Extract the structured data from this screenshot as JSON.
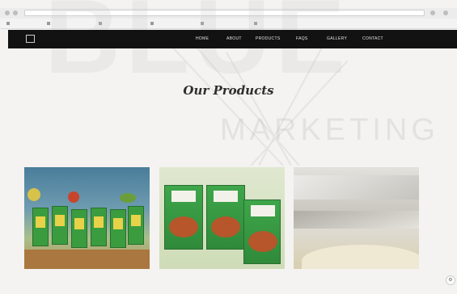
{
  "browser": {
    "address": "",
    "bookmarks": [
      "",
      "",
      "",
      "",
      "",
      ""
    ]
  },
  "brand": {
    "name": "",
    "tagline": ""
  },
  "nav": {
    "items": [
      "HOME",
      "ABOUT",
      "PRODUCTS",
      "FAQS",
      "GALLERY",
      "CONTACT",
      ""
    ]
  },
  "watermark": {
    "big": "BLUE",
    "small": "MARKETING"
  },
  "section": {
    "title": "Our Products"
  },
  "filters": {
    "items": [
      "",
      "",
      "",
      "",
      "",
      "",
      "",
      "",
      "",
      "",
      "",
      "",
      ""
    ]
  },
  "products": [
    {
      "caption": ""
    },
    {
      "caption": ""
    },
    {
      "caption": ""
    }
  ],
  "colors": {
    "nav_bg": "#121212",
    "page_bg": "#f4f3f1",
    "pack_green": "#3a9c3f"
  },
  "icons": {
    "fab": "settings-icon"
  }
}
